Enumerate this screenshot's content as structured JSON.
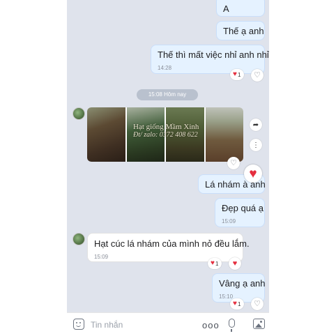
{
  "messages": {
    "m0": {
      "text": "A"
    },
    "m1": {
      "text": "Thế ạ anh"
    },
    "m2": {
      "text": "Thế thì mất việc nhỉ anh nhỉ",
      "time": "14:28",
      "reaction_count": "1"
    },
    "separator": {
      "text": "15:08 Hôm nay"
    },
    "image": {
      "watermark_line1": "Hạt giống Mầm Xinh",
      "watermark_line2": "Đt/ zalo: 0372 408 622"
    },
    "m3": {
      "text": "Lá nhám à anh"
    },
    "m4": {
      "text": "Đẹp quá ạ",
      "time": "15:09"
    },
    "m5": {
      "text": "Hạt cúc lá nhám của mình nỏ đều lắm.",
      "time": "15:09",
      "reaction_count": "1"
    },
    "m6": {
      "text": "Vâng ạ anh",
      "time": "15:10",
      "reaction_count": "1"
    }
  },
  "input": {
    "placeholder": "Tin nhắn",
    "more": "ooo"
  },
  "icons": {
    "heart": "heart-icon",
    "like": "heart-outline-icon",
    "share": "share-arrow-icon",
    "more": "more-dots-icon",
    "sticker": "sticker-icon",
    "mic": "microphone-icon",
    "gallery": "image-icon"
  },
  "colors": {
    "accent_red": "#e52e3e",
    "outgoing_bubble": "#e5f2ff",
    "chat_bg": "#dfe3ec"
  }
}
